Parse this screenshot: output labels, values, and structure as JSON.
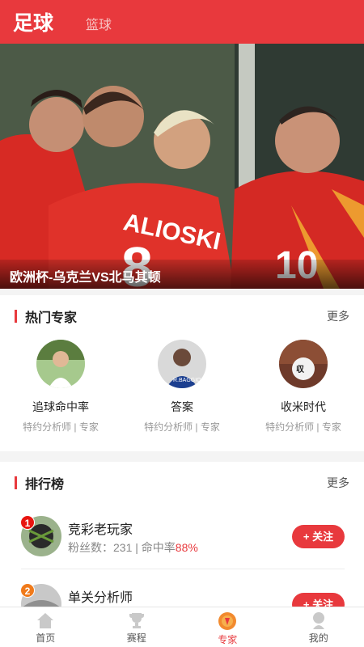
{
  "header": {
    "active_tab": "足球",
    "inactive_tab": "篮球"
  },
  "banner": {
    "caption": "欧洲杯-乌克兰VS北马其顿"
  },
  "experts": {
    "title": "热门专家",
    "more": "更多",
    "items": [
      {
        "name": "追球命中率",
        "role": "特约分析师 | 专家"
      },
      {
        "name": "答案",
        "role": "特约分析师 | 专家"
      },
      {
        "name": "收米时代",
        "role": "特约分析师 | 专家"
      }
    ]
  },
  "ranking": {
    "title": "排行榜",
    "more": "更多",
    "items": [
      {
        "rank": "1",
        "name": "竞彩老玩家",
        "fans_label": "粉丝数：231",
        "sep": " | ",
        "hit_label": "命中率",
        "hit_value": "88%",
        "follow": "+ 关注",
        "badge_color": "#e8140f"
      },
      {
        "rank": "2",
        "name": "单关分析师",
        "fans_label": "",
        "sep": "",
        "hit_label": "",
        "hit_value": "",
        "follow": "+ 关注",
        "badge_color": "#f07a1a"
      }
    ]
  },
  "tabbar": {
    "items": [
      {
        "label": "首页",
        "icon": "home-icon"
      },
      {
        "label": "赛程",
        "icon": "trophy-icon"
      },
      {
        "label": "专家",
        "icon": "expert-icon"
      },
      {
        "label": "我的",
        "icon": "user-icon"
      }
    ]
  },
  "colors": {
    "accent": "#e8393d"
  }
}
